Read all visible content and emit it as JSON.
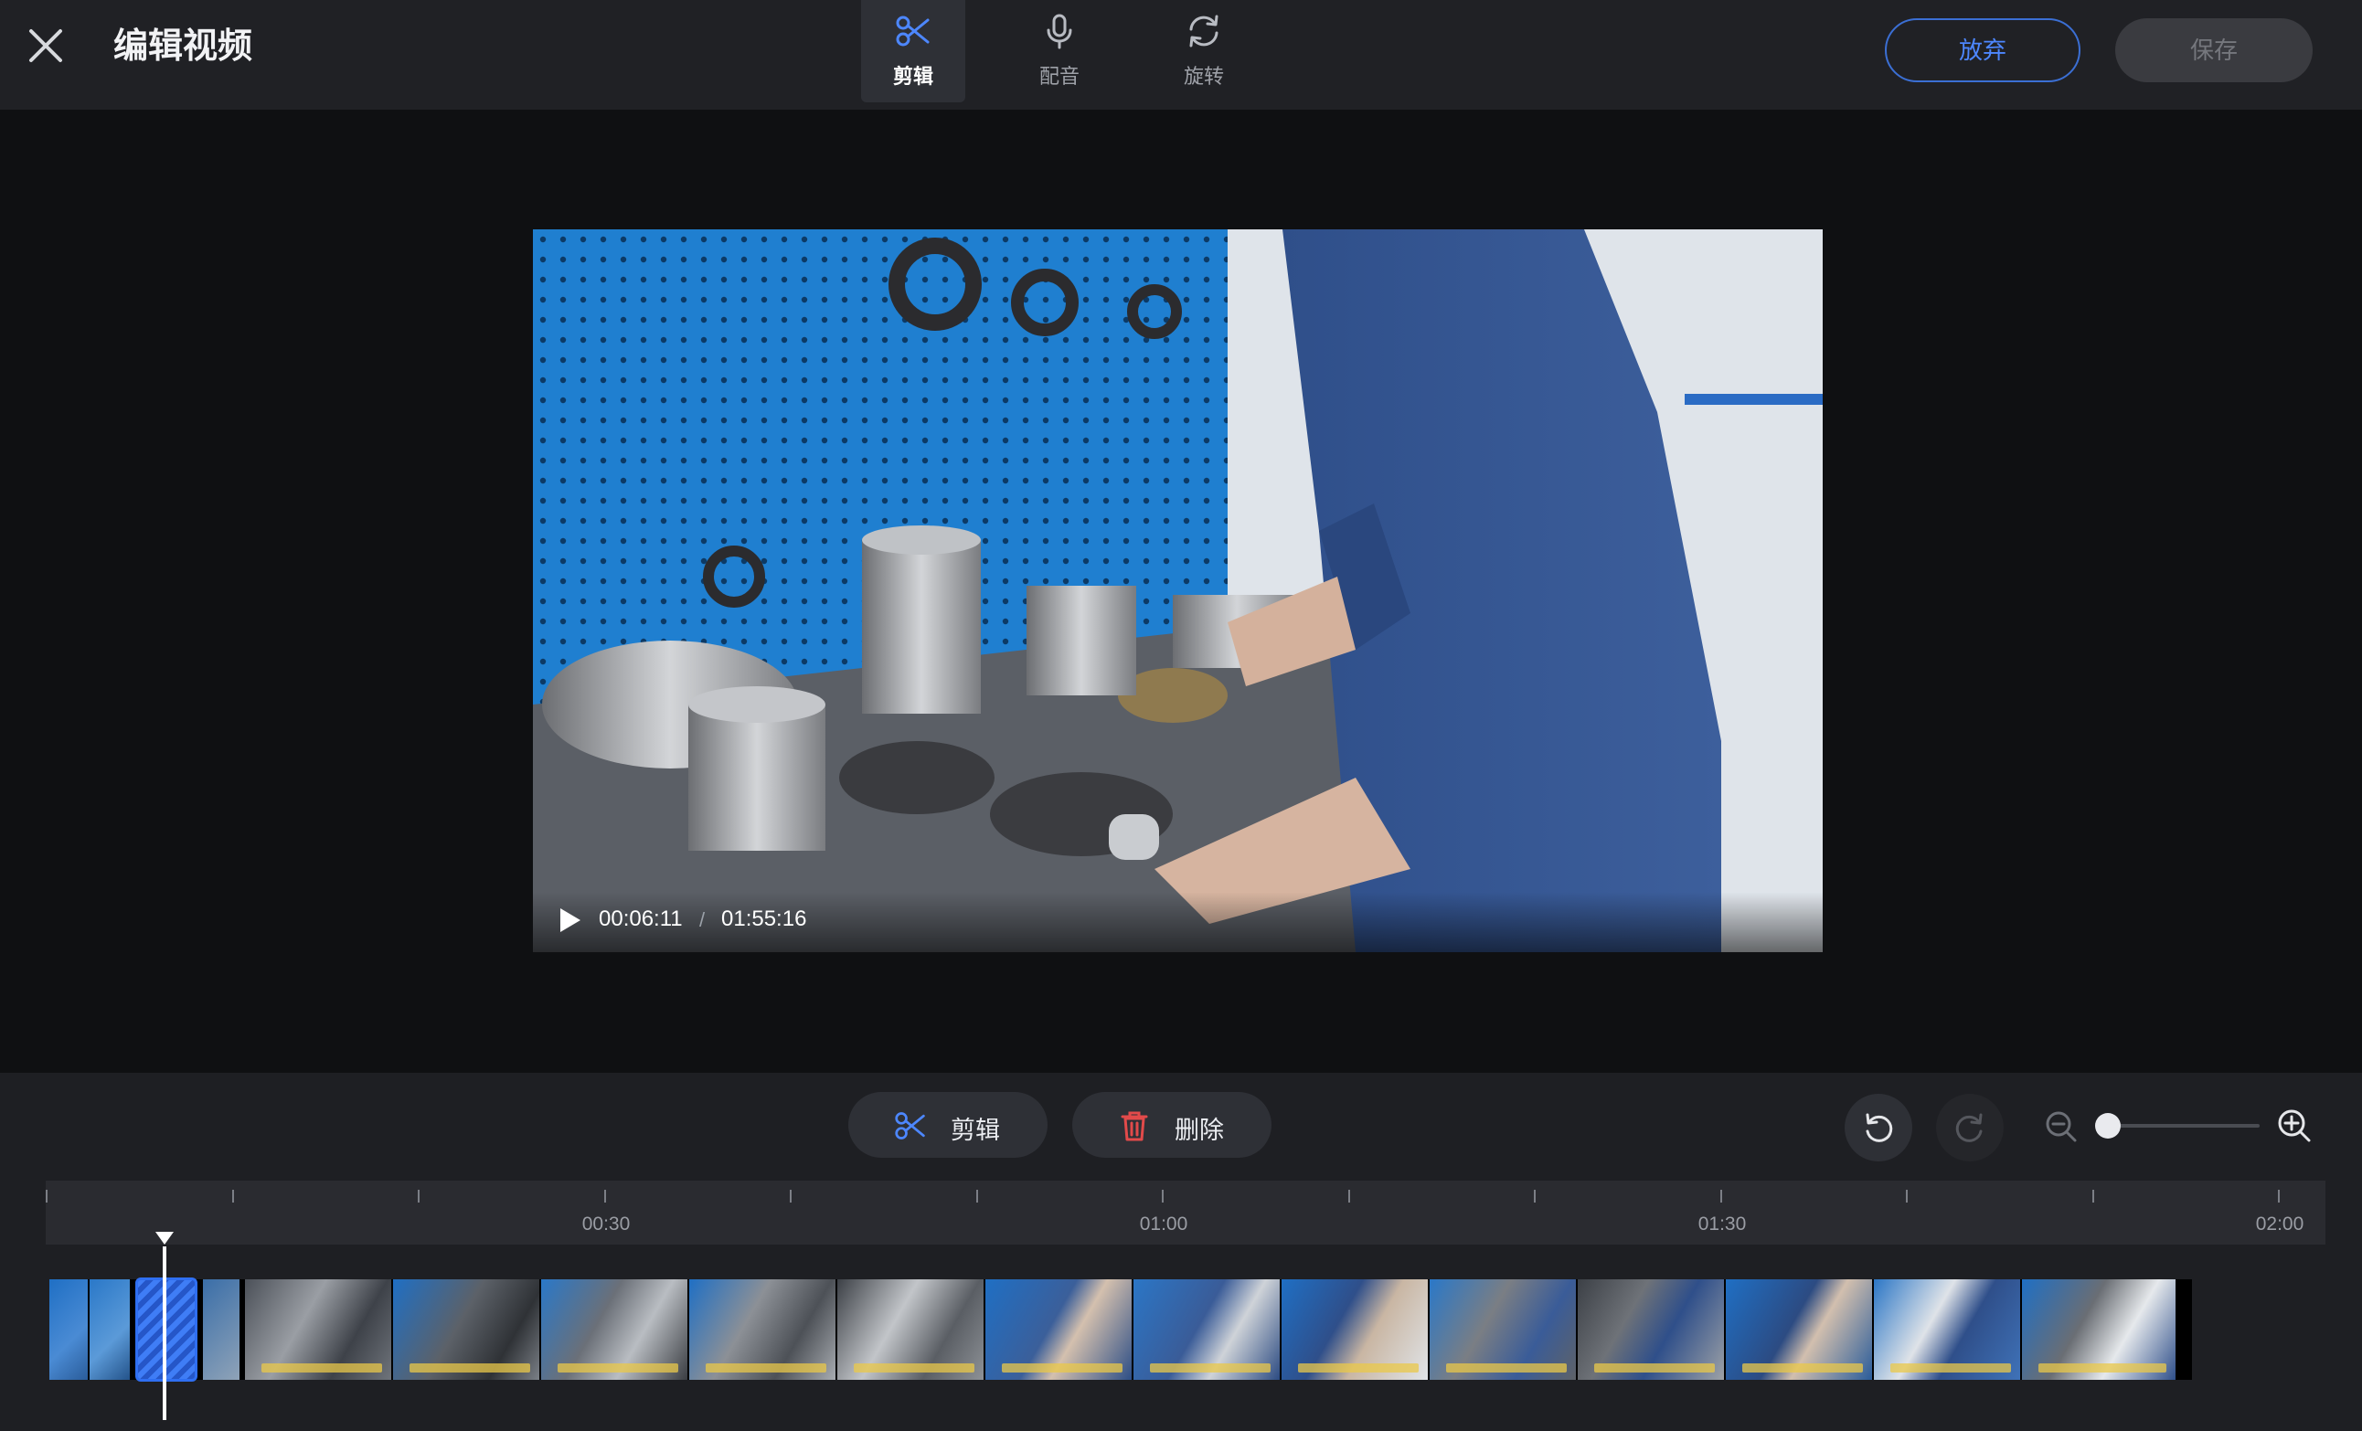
{
  "header": {
    "title": "编辑视频",
    "tabs": [
      {
        "label": "剪辑",
        "icon": "scissors-icon",
        "active": true
      },
      {
        "label": "配音",
        "icon": "microphone-icon",
        "active": false
      },
      {
        "label": "旋转",
        "icon": "rotate-icon",
        "active": false
      }
    ],
    "discard_label": "放弃",
    "save_label": "保存"
  },
  "player": {
    "current_time": "00:06:11",
    "separator": "/",
    "total_time": "01:55:16"
  },
  "editor": {
    "cut_label": "剪辑",
    "delete_label": "删除",
    "zoom_level": 0
  },
  "timeline": {
    "labels": [
      "00:30",
      "01:00",
      "01:30",
      "02:00"
    ]
  },
  "colors": {
    "accent": "#3b6fd4",
    "delete_red": "#e24a4a",
    "topbar": "#202125",
    "editor_bg": "#1e1f23"
  }
}
